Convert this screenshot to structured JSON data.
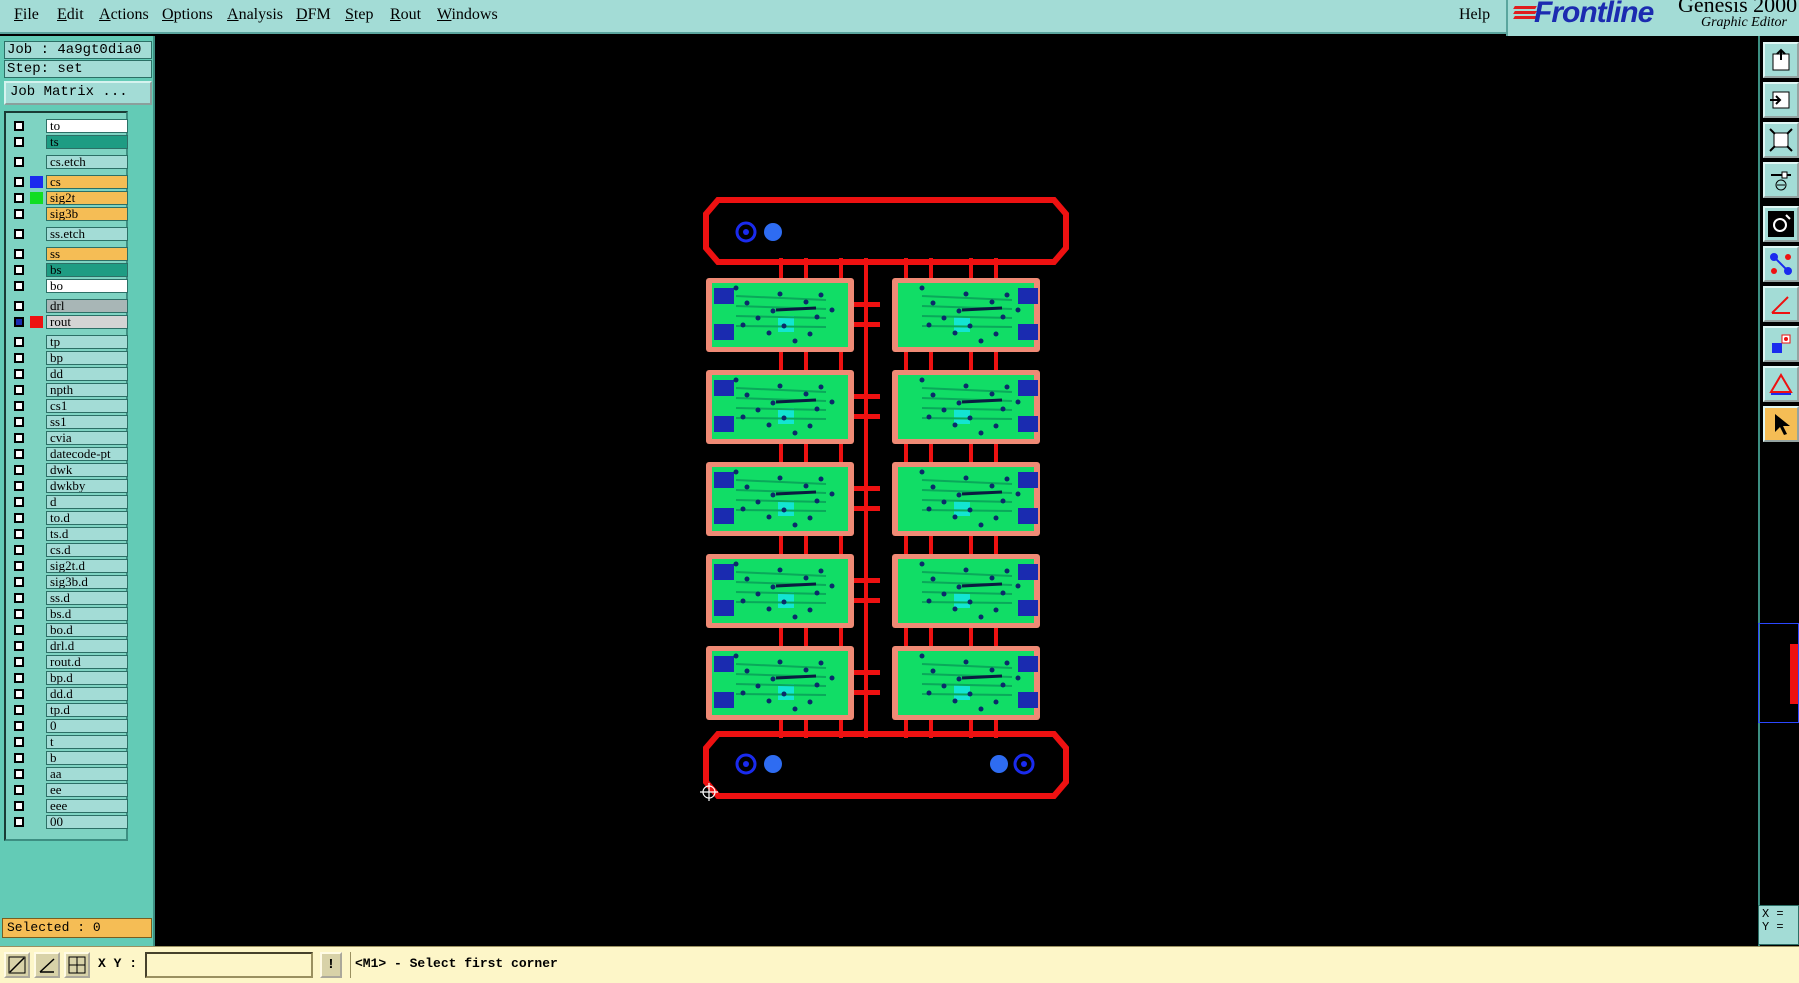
{
  "menu": {
    "items": [
      "File",
      "Edit",
      "Actions",
      "Options",
      "Analysis",
      "DFM",
      "Step",
      "Rout",
      "Windows"
    ],
    "help": "Help"
  },
  "brand": {
    "logo": "Frontline",
    "product": "Genesis 2000",
    "subtitle": "Graphic Editor"
  },
  "left_panel": {
    "job": "Job : 4a9gt0dia0",
    "step": "Step: set",
    "job_matrix_button": "Job Matrix ...",
    "selected": "Selected : 0",
    "layers": [
      {
        "name": "to",
        "bg": "#ffffff",
        "swatch": null,
        "checked": false
      },
      {
        "name": "ts",
        "bg": "#1e9c83",
        "swatch": null,
        "checked": false
      },
      {
        "name": "cs.etch",
        "bg": "#a3dcd6",
        "swatch": null,
        "checked": false,
        "gap_before": true
      },
      {
        "name": "cs",
        "bg": "#f5bd55",
        "swatch": "#1a2bee",
        "checked": false,
        "gap_before": true
      },
      {
        "name": "sig2t",
        "bg": "#f5bd55",
        "swatch": "#11dd22",
        "checked": false
      },
      {
        "name": "sig3b",
        "bg": "#f5bd55",
        "swatch": null,
        "checked": false
      },
      {
        "name": "ss.etch",
        "bg": "#a3dcd6",
        "swatch": null,
        "checked": false,
        "gap_before": true
      },
      {
        "name": "ss",
        "bg": "#f5bd55",
        "swatch": null,
        "checked": false,
        "gap_before": true
      },
      {
        "name": "bs",
        "bg": "#1e9c83",
        "swatch": null,
        "checked": false
      },
      {
        "name": "bo",
        "bg": "#ffffff",
        "swatch": null,
        "checked": false
      },
      {
        "name": "drl",
        "bg": "#a8b6b6",
        "swatch": null,
        "checked": false,
        "gap_before": true
      },
      {
        "name": "rout",
        "bg": "#d4d4d4",
        "swatch": "#ee1111",
        "checked": true
      },
      {
        "name": "tp",
        "bg": "#a3dcd6",
        "swatch": null,
        "checked": false,
        "gap_before": true
      },
      {
        "name": "bp",
        "bg": "#a3dcd6",
        "swatch": null,
        "checked": false
      },
      {
        "name": "dd",
        "bg": "#a3dcd6",
        "swatch": null,
        "checked": false
      },
      {
        "name": "npth",
        "bg": "#a3dcd6",
        "swatch": null,
        "checked": false
      },
      {
        "name": "cs1",
        "bg": "#a3dcd6",
        "swatch": null,
        "checked": false
      },
      {
        "name": "ss1",
        "bg": "#a3dcd6",
        "swatch": null,
        "checked": false
      },
      {
        "name": "cvia",
        "bg": "#a3dcd6",
        "swatch": null,
        "checked": false
      },
      {
        "name": "datecode-pt",
        "bg": "#a3dcd6",
        "swatch": null,
        "checked": false
      },
      {
        "name": "dwk",
        "bg": "#a3dcd6",
        "swatch": null,
        "checked": false
      },
      {
        "name": "dwkby",
        "bg": "#a3dcd6",
        "swatch": null,
        "checked": false
      },
      {
        "name": "d",
        "bg": "#a3dcd6",
        "swatch": null,
        "checked": false
      },
      {
        "name": "to.d",
        "bg": "#a3dcd6",
        "swatch": null,
        "checked": false
      },
      {
        "name": "ts.d",
        "bg": "#a3dcd6",
        "swatch": null,
        "checked": false
      },
      {
        "name": "cs.d",
        "bg": "#a3dcd6",
        "swatch": null,
        "checked": false
      },
      {
        "name": "sig2t.d",
        "bg": "#a3dcd6",
        "swatch": null,
        "checked": false
      },
      {
        "name": "sig3b.d",
        "bg": "#a3dcd6",
        "swatch": null,
        "checked": false
      },
      {
        "name": "ss.d",
        "bg": "#a3dcd6",
        "swatch": null,
        "checked": false
      },
      {
        "name": "bs.d",
        "bg": "#a3dcd6",
        "swatch": null,
        "checked": false
      },
      {
        "name": "bo.d",
        "bg": "#a3dcd6",
        "swatch": null,
        "checked": false
      },
      {
        "name": "drl.d",
        "bg": "#a3dcd6",
        "swatch": null,
        "checked": false
      },
      {
        "name": "rout.d",
        "bg": "#a3dcd6",
        "swatch": null,
        "checked": false
      },
      {
        "name": "bp.d",
        "bg": "#a3dcd6",
        "swatch": null,
        "checked": false
      },
      {
        "name": "dd.d",
        "bg": "#a3dcd6",
        "swatch": null,
        "checked": false
      },
      {
        "name": "tp.d",
        "bg": "#a3dcd6",
        "swatch": null,
        "checked": false
      },
      {
        "name": "0",
        "bg": "#a3dcd6",
        "swatch": null,
        "checked": false
      },
      {
        "name": "t",
        "bg": "#a3dcd6",
        "swatch": null,
        "checked": false
      },
      {
        "name": "b",
        "bg": "#a3dcd6",
        "swatch": null,
        "checked": false
      },
      {
        "name": "aa",
        "bg": "#a3dcd6",
        "swatch": null,
        "checked": false
      },
      {
        "name": "ee",
        "bg": "#a3dcd6",
        "swatch": null,
        "checked": false
      },
      {
        "name": "eee",
        "bg": "#a3dcd6",
        "swatch": null,
        "checked": false
      },
      {
        "name": "00",
        "bg": "#a3dcd6",
        "swatch": null,
        "checked": false
      }
    ]
  },
  "right_toolbar": {
    "buttons": [
      "export-icon",
      "import-icon",
      "zoom-fit-icon",
      "settings-slider-icon",
      "snap-circle-icon",
      "connect-nodes-icon",
      "measure-angle-icon",
      "select-shapes-icon",
      "triangle-tool-icon",
      "select-pointer-icon"
    ],
    "active_button": "select-pointer-icon",
    "coord_x": "X =",
    "coord_y": "Y ="
  },
  "bottom_bar": {
    "xy_label": "X Y :",
    "xy_value": "",
    "info_button": "!",
    "prompt": "<M1> - Select first corner"
  },
  "colors": {
    "panel_teal": "#63cbb6",
    "panel_light": "#a3dcd6",
    "highlight_orange": "#f5bd55",
    "rout_red": "#ee1111",
    "copper_green": "#11dd66",
    "pad_blue": "#1a2bee",
    "mask_salmon": "#ef8a75"
  },
  "canvas": {
    "panel_grid": {
      "rows": 5,
      "cols": 2
    }
  }
}
